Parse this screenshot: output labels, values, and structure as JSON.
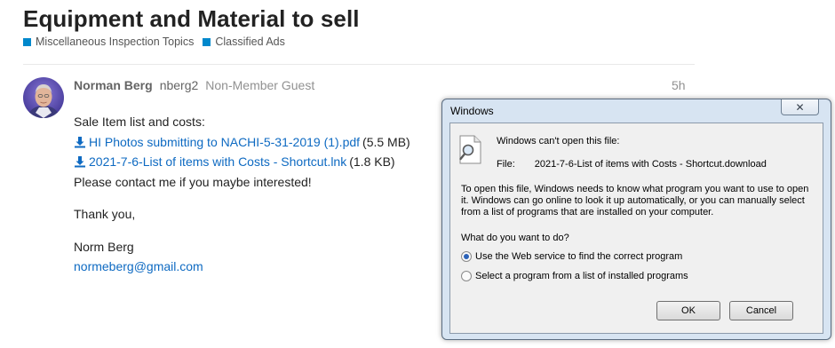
{
  "topic": {
    "title": "Equipment and Material to sell",
    "categories": [
      "Miscellaneous Inspection Topics",
      "Classified Ads"
    ],
    "category_color": "#0088cc"
  },
  "post": {
    "username": "Norman Berg",
    "handle": "nberg2",
    "user_title": "Non-Member Guest",
    "age": "5h",
    "intro": "Sale Item list and costs:",
    "attachments": [
      {
        "name": "HI Photos submitting to NACHI-5-31-2019 (1).pdf",
        "size": "(5.5 MB)"
      },
      {
        "name": "2021-7-6-List of items with Costs - Shortcut.lnk",
        "size": "(1.8 KB)"
      }
    ],
    "line_contact": "Please contact me if you maybe interested!",
    "thanks": "Thank you,",
    "signature": "Norm Berg",
    "email": "normeberg@gmail.com",
    "link_color": "#0e6ac2"
  },
  "dialog": {
    "title": "Windows",
    "close_glyph": "✕",
    "heading": "Windows can't open this file:",
    "file_label": "File:",
    "file_name": "2021-7-6-List of items with Costs - Shortcut.download",
    "description": "To open this file, Windows needs to know what program you want to use to open it. Windows can go online to look it up automatically, or you can manually select from a list of programs that are installed on your computer.",
    "question": "What do you want to do?",
    "options": [
      {
        "label": "Use the Web service to find the correct program",
        "selected": true
      },
      {
        "label": "Select a program from a list of installed programs",
        "selected": false
      }
    ],
    "ok_label": "OK",
    "cancel_label": "Cancel",
    "icon": "unknown-file-search-icon"
  }
}
